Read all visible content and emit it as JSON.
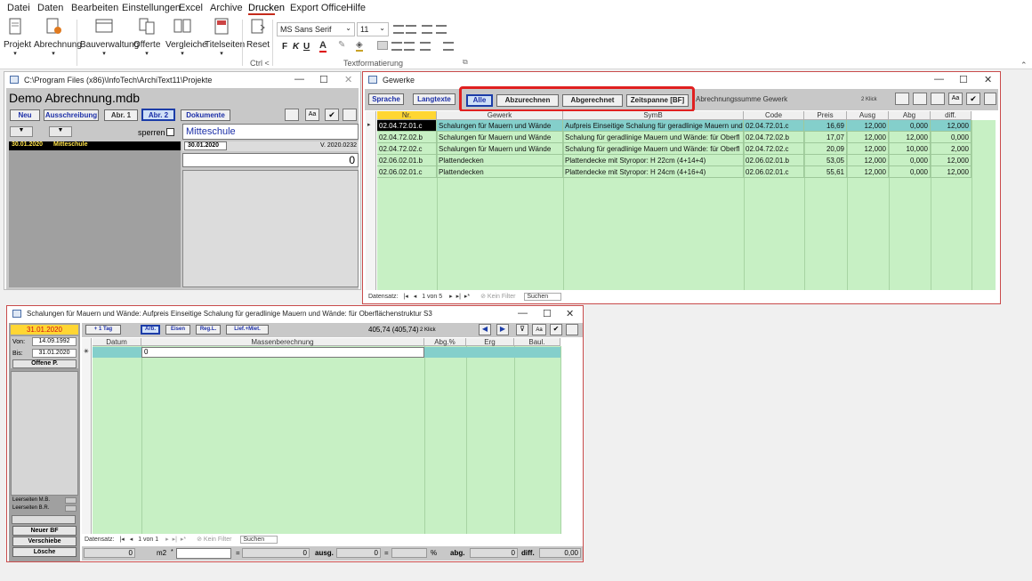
{
  "menu": [
    "Datei",
    "Daten",
    "Bearbeiten",
    "Einstellungen",
    "Excel",
    "Archive",
    "Drucken",
    "Export Office",
    "Hilfe"
  ],
  "ribbon": {
    "buttons": [
      "Projekt",
      "Abrechnung",
      "Bauverwaltung",
      "Offerte",
      "Vergleiche",
      "Titelseiten",
      "Reset"
    ],
    "reset_sub": "Ctrl <",
    "font_name": "MS Sans Serif",
    "font_size": "11",
    "group_label": "Textformatierung",
    "bold": "F",
    "italic": "K",
    "underline": "U"
  },
  "project_window": {
    "title": "C:\\Program Files (x86)\\InfoTech\\ArchiText11\\Projekte",
    "db_name": "Demo Abrechnung.mdb",
    "buttons": [
      "Neu",
      "Ausschreibung",
      "Abr. 1",
      "Abr. 2",
      "Dokumente"
    ],
    "sperren_label": "sperren",
    "project_name": "Mitteschule",
    "list_date": "30.01.2020",
    "list_name": "Mitteschule",
    "date": "30.01.2020",
    "version": "V. 2020.0232",
    "amount": "0"
  },
  "gewerke_window": {
    "title": "Gewerke",
    "buttons": [
      "Sprache",
      "Langtexte"
    ],
    "filter_buttons": [
      "Alle",
      "Abzurechnen",
      "Abgerechnet",
      "Zeitspanne [BF]"
    ],
    "sum_label": "Abrechnungssumme Gewerk",
    "klick": "2 Klick",
    "columns": [
      "Nr.",
      "Gewerk",
      "SymB",
      "Code",
      "Preis",
      "Ausg",
      "Abg",
      "diff."
    ],
    "rows": [
      [
        "02.04.72.01.c",
        "Schalungen für Mauern und Wände",
        "Aufpreis Einseitige Schalung für geradlinige Mauern und",
        "02.04.72.01.c",
        "16,69",
        "12,000",
        "0,000",
        "12,000"
      ],
      [
        "02.04.72.02.b",
        "Schalungen für Mauern und Wände",
        "Schalung für geradlinige Mauern und Wände: für Oberfl",
        "02.04.72.02.b",
        "17,07",
        "12,000",
        "12,000",
        "0,000"
      ],
      [
        "02.04.72.02.c",
        "Schalungen für Mauern und Wände",
        "Schalung für geradlinige Mauern und Wände: für Oberfl",
        "02.04.72.02.c",
        "20,09",
        "12,000",
        "10,000",
        "2,000"
      ],
      [
        "02.06.02.01.b",
        "Plattendecken",
        "Plattendecke mit Styropor: H 22cm (4+14+4)",
        "02.06.02.01.b",
        "53,05",
        "12,000",
        "0,000",
        "12,000"
      ],
      [
        "02.06.02.01.c",
        "Plattendecken",
        "Plattendecke mit Styropor: H 24cm (4+16+4)",
        "02.06.02.01.c",
        "55,61",
        "12,000",
        "0,000",
        "12,000"
      ]
    ],
    "status": {
      "label": "Datensatz:",
      "pos": "1 von 5",
      "filter": "Kein Filter",
      "search": "Suchen"
    }
  },
  "detail_window": {
    "title": "Schalungen für Mauern und Wände: Aufpreis Einseitige Schalung für geradlinige Mauern und Wände: für Oberflächenstruktur S3",
    "date_red": "31.01.2020",
    "von_label": "Von:",
    "von": "14.09.1992",
    "bis_label": "Bis:",
    "bis": "31.01.2020",
    "offene": "Offene P.",
    "leer_mb": "Leerseiten M.B.",
    "leer_br": "Leerseiten B.R.",
    "left_buttons": [
      "Neuer BF",
      "Verschiebe",
      "Lösche"
    ],
    "buttons": [
      "+ 1 Tag",
      "Arb.",
      "Eisen",
      "Reg.L.",
      "Lief.+Miet."
    ],
    "sum": "405,74 (405,74)",
    "klick": "2 Klick",
    "columns": [
      "Datum",
      "Massenberechnung",
      "Abg.%",
      "Erg",
      "Baul."
    ],
    "row_value": "0",
    "status": {
      "label": "Datensatz:",
      "pos": "1 von 1",
      "filter": "Kein Filter",
      "search": "Suchen"
    },
    "footer": {
      "v1": "0",
      "unit": "m2",
      "eq1": "=",
      "v2": "0",
      "ausg_label": "ausg.",
      "v3": "0",
      "eq2": "=",
      "pct": "%",
      "abg_label": "abg.",
      "v4": "0",
      "diff_label": "diff.",
      "v5": "0,00"
    }
  }
}
